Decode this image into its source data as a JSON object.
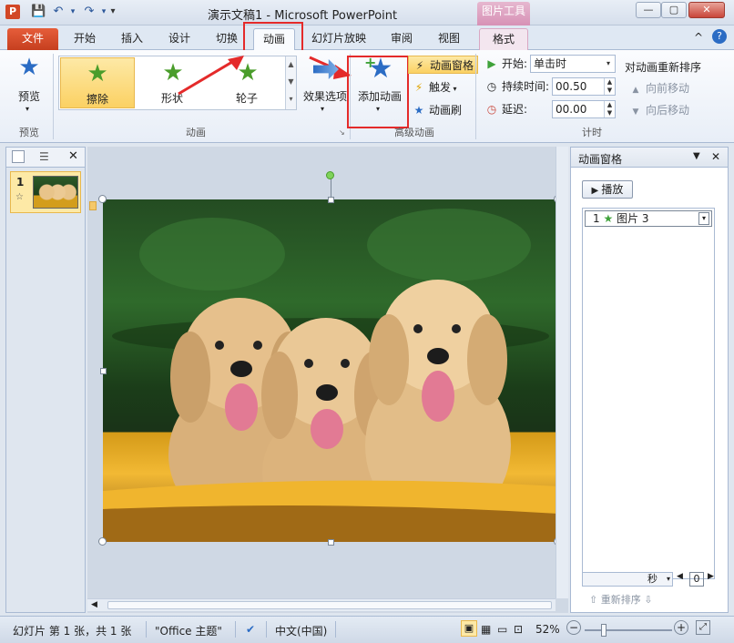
{
  "window": {
    "title": "演示文稿1 - Microsoft PowerPoint",
    "context_group": "图片工具",
    "app_icon": "P"
  },
  "tabs": [
    "文件",
    "开始",
    "插入",
    "设计",
    "切换",
    "动画",
    "幻灯片放映",
    "审阅",
    "视图",
    "格式"
  ],
  "ribbon": {
    "preview": {
      "label": "预览",
      "group": "预览"
    },
    "animation_gallery": {
      "items": [
        "擦除",
        "形状",
        "轮子"
      ],
      "selected": "擦除",
      "group": "动画"
    },
    "effect_options": "效果选项",
    "advanced": {
      "add_animation": "添加动画",
      "animation_pane": "动画窗格",
      "trigger": "触发",
      "animation_painter": "动画刷",
      "group": "高级动画"
    },
    "timing": {
      "start_label": "开始:",
      "start_value": "单击时",
      "duration_label": "持续时间:",
      "duration_value": "00.50",
      "delay_label": "延迟:",
      "delay_value": "00.00",
      "reorder_title": "对动画重新排序",
      "move_earlier": "向前移动",
      "move_later": "向后移动",
      "group": "计时"
    }
  },
  "slides": {
    "number": "1"
  },
  "anim_pane": {
    "title": "动画窗格",
    "play": "播放",
    "items": [
      {
        "index": "1",
        "name": "图片 3"
      }
    ],
    "unit": "秒",
    "zoom": "0",
    "reorder_label": "重新排序"
  },
  "status": {
    "slide_info": "幻灯片 第 1 张，共 1 张",
    "theme": "\"Office 主题\"",
    "language": "中文(中国)",
    "zoom": "52%"
  }
}
